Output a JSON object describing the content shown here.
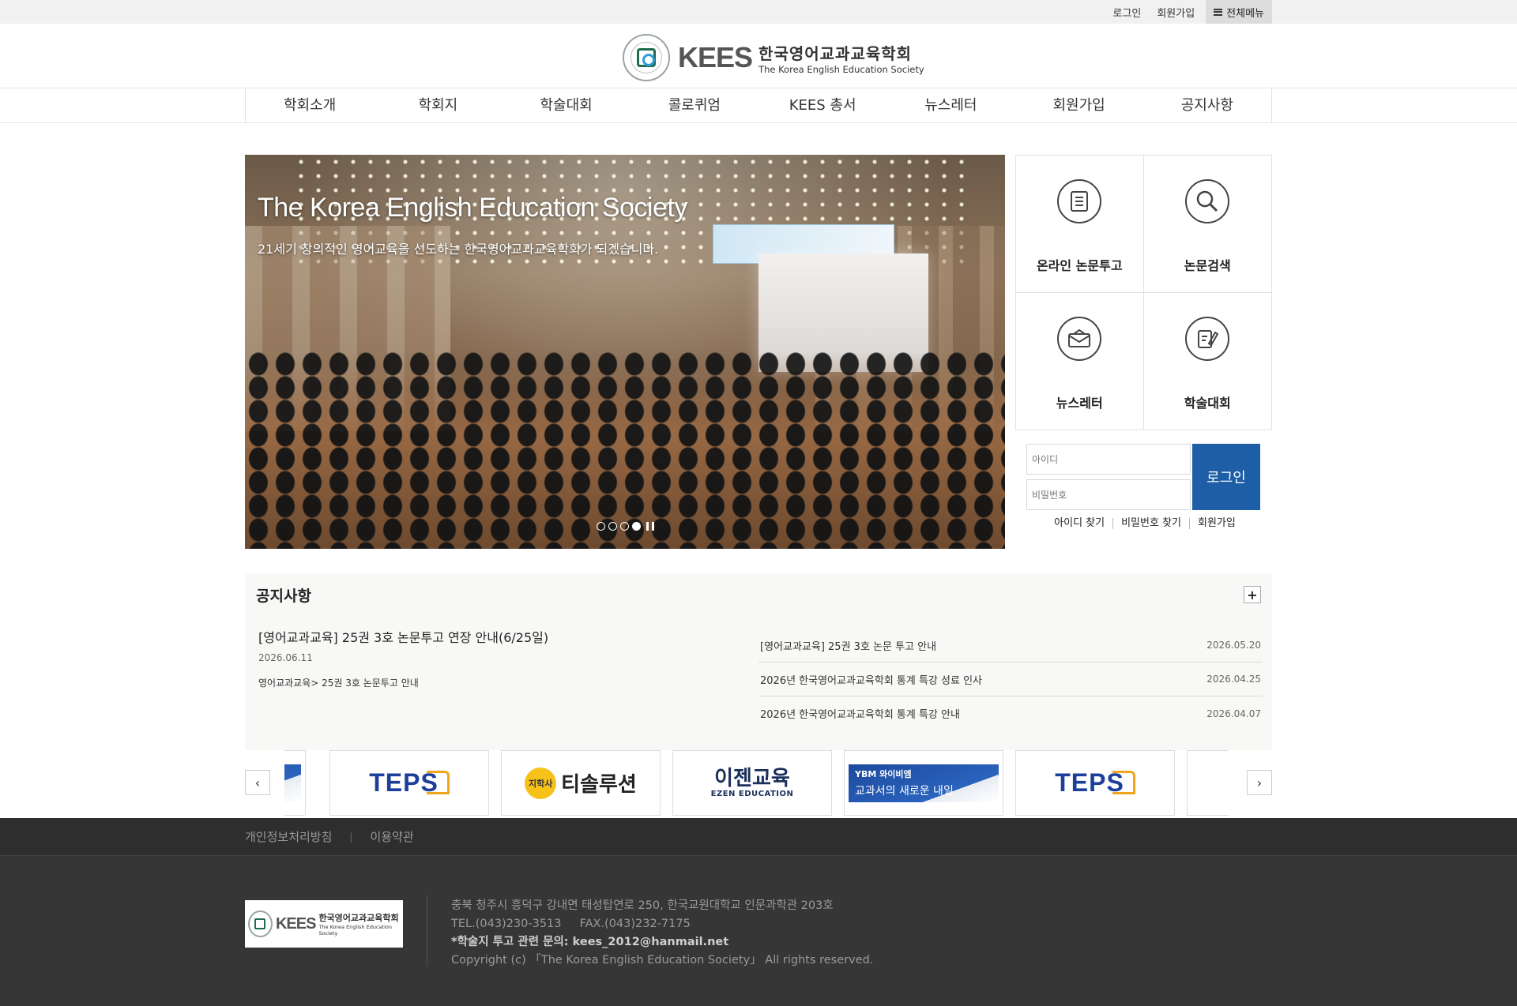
{
  "topbar": {
    "login": "로그인",
    "join": "회원가입",
    "allmenu": "전체메뉴"
  },
  "logo": {
    "brand": "KEES",
    "name_ko": "한국영어교과교육학회",
    "name_en": "The Korea English Education Society"
  },
  "nav": [
    "학회소개",
    "학회지",
    "학술대회",
    "콜로퀴엄",
    "KEES 총서",
    "뉴스레터",
    "회원가입",
    "공지사항"
  ],
  "hero": {
    "title": "The Korea English Education Society",
    "subtitle": "21세기 창의적인 영어교육을 선도하는 한국영어교과교육학회가 되겠습니다.",
    "slide_count": 4,
    "active_slide": 4
  },
  "quick_links": [
    {
      "label": "온라인 논문투고",
      "icon": "document-icon"
    },
    {
      "label": "논문검색",
      "icon": "search-icon"
    },
    {
      "label": "뉴스레터",
      "icon": "envelope-icon"
    },
    {
      "label": "학술대회",
      "icon": "clipboard-pen-icon"
    }
  ],
  "login": {
    "id_placeholder": "아이디",
    "pw_placeholder": "비밀번호",
    "button": "로그인",
    "find_id": "아이디 찾기",
    "find_pw": "비밀번호 찾기",
    "join": "회원가입"
  },
  "notice": {
    "heading": "공지사항",
    "more": "+",
    "featured": {
      "title": "[영어교과교육] 25권 3호 논문투고 연장 안내(6/25일)",
      "date": "2026.06.11",
      "excerpt": "영어교과교육> 25권 3호 논문투고 안내"
    },
    "items": [
      {
        "title": "[영어교과교육] 25권 3호 논문 투고 안내",
        "date": "2026.05.20"
      },
      {
        "title": "2026년 한국영어교과교육학회 통계 특강 성료 인사",
        "date": "2026.04.25"
      },
      {
        "title": "2026년 한국영어교과교육학회 통계 특강 안내",
        "date": "2026.04.07"
      }
    ]
  },
  "partners": {
    "prev": "‹",
    "next": "›",
    "teps": "TEPS",
    "tsol_badge": "지학사",
    "tsol_name": "티솔루션",
    "ezen_ko": "이젠교육",
    "ezen_en": "EZEN EDUCATION",
    "ybm_brand": "YBM 와이비엠",
    "ybm_slogan": "교과서의 새로운 내일"
  },
  "footer": {
    "privacy": "개인정보처리방침",
    "separator": "|",
    "terms": "이용약관",
    "address": "충북 청주시 흥덕구 강내면 태성탑연로 250, 한국교원대학교 인문과학관 203호",
    "tel": "TEL.(043)230-3513",
    "fax": "FAX.(043)232-7175",
    "inquiry": "*학술지 투고 관련 문의: kees_2012@hanmail.net",
    "copyright": "Copyright (c) 「The Korea English Education Society」 All rights reserved."
  }
}
